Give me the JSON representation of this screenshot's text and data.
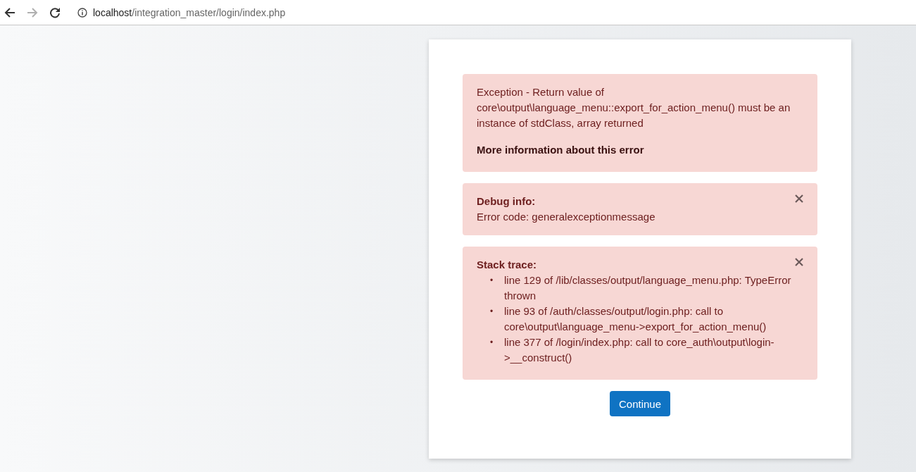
{
  "browser": {
    "back_disabled": false,
    "forward_disabled": true,
    "url_host": "localhost",
    "url_path": "/integration_master/login/index.php"
  },
  "alerts": [
    {
      "kind": "message",
      "dismissible": false,
      "text": "Exception - Return value of core\\output\\language_menu::export_for_action_menu() must be an instance of stdClass, array returned",
      "link": "More information about this error"
    },
    {
      "kind": "debug",
      "dismissible": true,
      "title": "Debug info:",
      "text": "Error code: generalexceptionmessage"
    },
    {
      "kind": "trace",
      "dismissible": true,
      "title": "Stack trace:",
      "items": [
        {
          "bullet": "•",
          "text": "line 129 of /lib/classes/output/language_menu.php: TypeError thrown"
        },
        {
          "bullet": "•",
          "text": "line 93 of /auth/classes/output/login.php: call to core\\output\\language_menu->export_for_action_menu()"
        },
        {
          "bullet": "•",
          "text": "line 377 of /login/index.php: call to core_auth\\output\\login->__construct()"
        }
      ]
    }
  ],
  "continue_button": "Continue"
}
